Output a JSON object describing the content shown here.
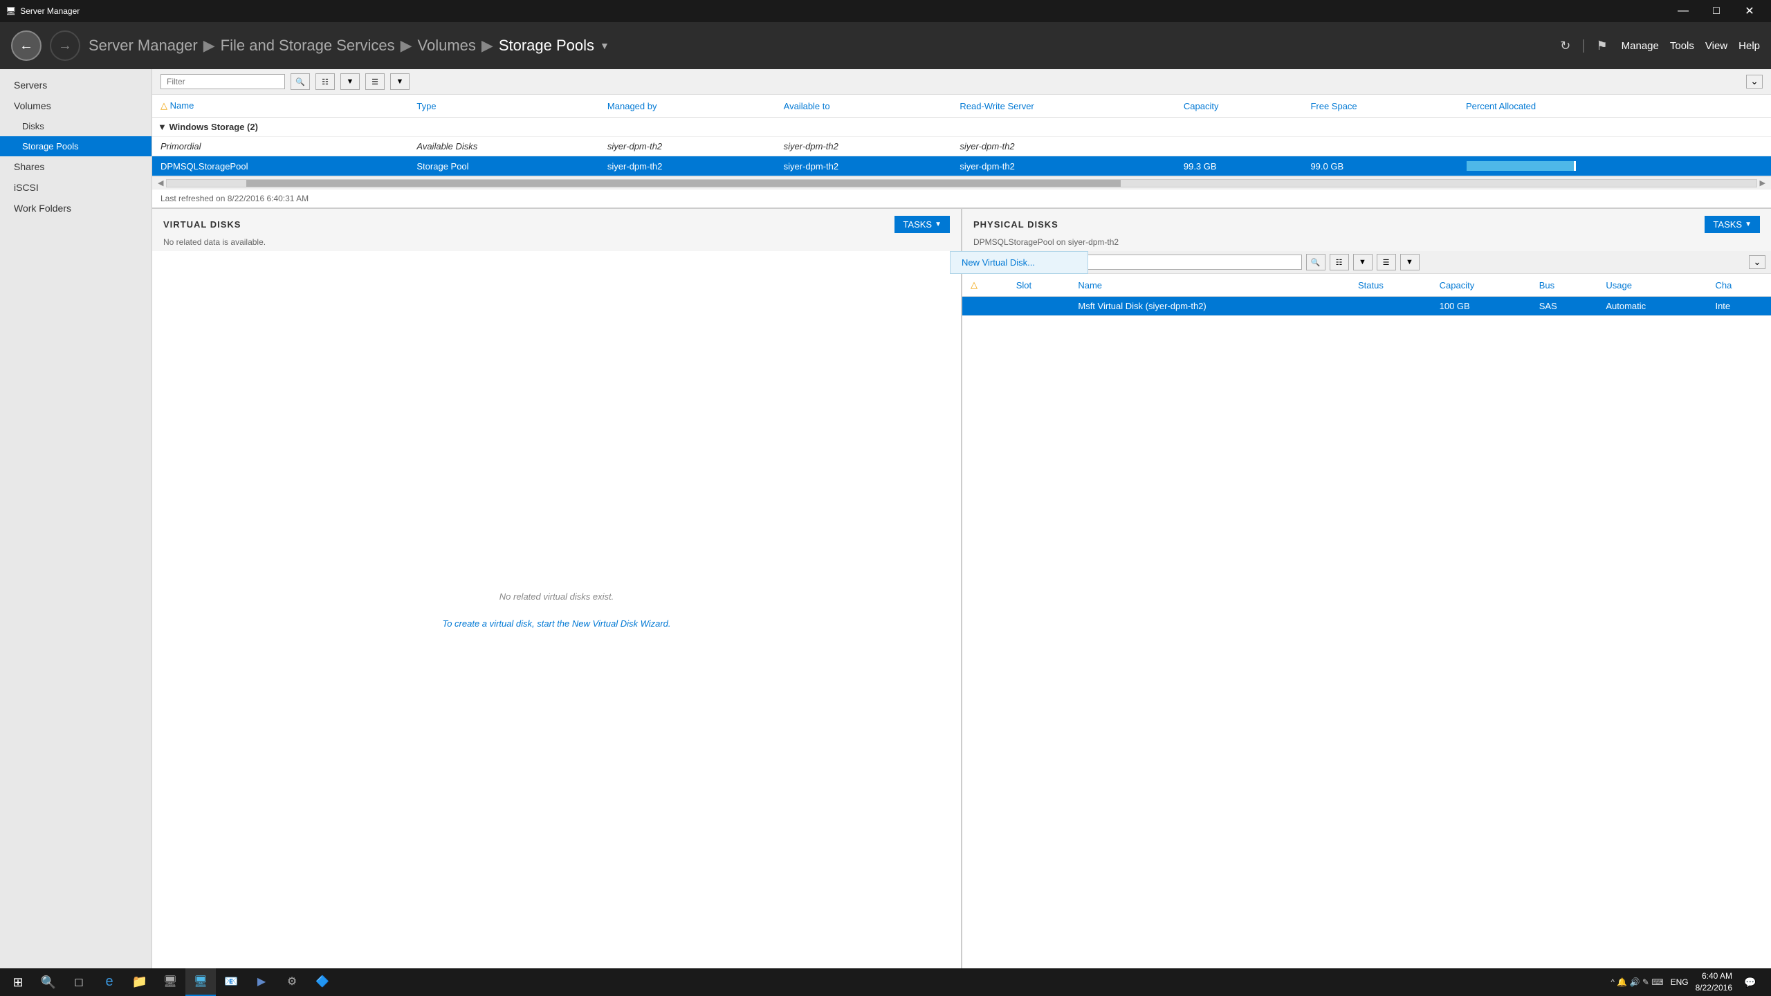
{
  "titlebar": {
    "icon": "🖥",
    "title": "Server Manager",
    "minimize": "—",
    "maximize": "□",
    "close": "✕"
  },
  "navbar": {
    "breadcrumb": [
      {
        "label": "Server Manager",
        "sep": "▶"
      },
      {
        "label": "File and Storage Services",
        "sep": "▶"
      },
      {
        "label": "Volumes",
        "sep": "▶"
      },
      {
        "label": "Storage Pools",
        "sep": ""
      }
    ],
    "menus": [
      "Manage",
      "Tools",
      "View",
      "Help"
    ]
  },
  "sidebar": {
    "items": [
      {
        "label": "Servers",
        "id": "servers",
        "sub": false
      },
      {
        "label": "Volumes",
        "id": "volumes",
        "sub": false
      },
      {
        "label": "Disks",
        "id": "disks",
        "sub": true
      },
      {
        "label": "Storage Pools",
        "id": "storage-pools",
        "sub": true,
        "active": true
      },
      {
        "label": "Shares",
        "id": "shares",
        "sub": false
      },
      {
        "label": "iSCSI",
        "id": "iscsi",
        "sub": false
      },
      {
        "label": "Work Folders",
        "id": "work-folders",
        "sub": false
      }
    ]
  },
  "storage_pools": {
    "filter_placeholder": "Filter",
    "columns": [
      {
        "label": "Name"
      },
      {
        "label": "Type"
      },
      {
        "label": "Managed by"
      },
      {
        "label": "Available to"
      },
      {
        "label": "Read-Write Server"
      },
      {
        "label": "Capacity"
      },
      {
        "label": "Free Space"
      },
      {
        "label": "Percent Allocated"
      }
    ],
    "group": {
      "label": "Windows Storage (2)",
      "rows": [
        {
          "name": "Primordial",
          "type": "Available Disks",
          "managed_by": "siyer-dpm-th2",
          "available_to": "siyer-dpm-th2",
          "rw_server": "siyer-dpm-th2",
          "capacity": "",
          "free_space": "",
          "percent_allocated": "",
          "italic": true,
          "selected": false
        },
        {
          "name": "DPMSQLStoragePool",
          "type": "Storage Pool",
          "managed_by": "siyer-dpm-th2",
          "available_to": "siyer-dpm-th2",
          "rw_server": "siyer-dpm-th2",
          "capacity": "99.3 GB",
          "free_space": "99.0 GB",
          "percent_allocated": 98,
          "italic": false,
          "selected": true
        }
      ]
    },
    "refresh_text": "Last refreshed on 8/22/2016 6:40:31 AM"
  },
  "virtual_disks": {
    "title": "VIRTUAL DISKS",
    "subtitle": "No related data is available.",
    "empty_text": "No related virtual disks exist.",
    "create_link": "To create a virtual disk, start the New Virtual Disk Wizard.",
    "tasks_label": "TASKS",
    "dropdown_visible": true,
    "dropdown_items": [
      {
        "label": "New Virtual Disk..."
      }
    ]
  },
  "physical_disks": {
    "title": "PHYSICAL DISKS",
    "subtitle": "DPMSQLStoragePool on siyer-dpm-th2",
    "tasks_label": "TASKS",
    "filter_placeholder": "Filter",
    "columns": [
      {
        "label": "Slot"
      },
      {
        "label": "Name"
      },
      {
        "label": "Status"
      },
      {
        "label": "Capacity"
      },
      {
        "label": "Bus"
      },
      {
        "label": "Usage"
      },
      {
        "label": "Cha"
      }
    ],
    "rows": [
      {
        "slot": "",
        "name": "Msft Virtual Disk (siyer-dpm-th2)",
        "status": "",
        "capacity": "100 GB",
        "bus": "SAS",
        "usage": "Automatic",
        "cha": "Inte",
        "selected": true
      }
    ]
  },
  "taskbar": {
    "time": "6:40 AM",
    "date": "8/22/2016",
    "lang": "ENG",
    "apps": [
      "⊞",
      "🔍",
      "□",
      "e",
      "📁",
      "📋",
      "🖥",
      "📧",
      "⚙",
      "▶",
      "🔷"
    ]
  }
}
